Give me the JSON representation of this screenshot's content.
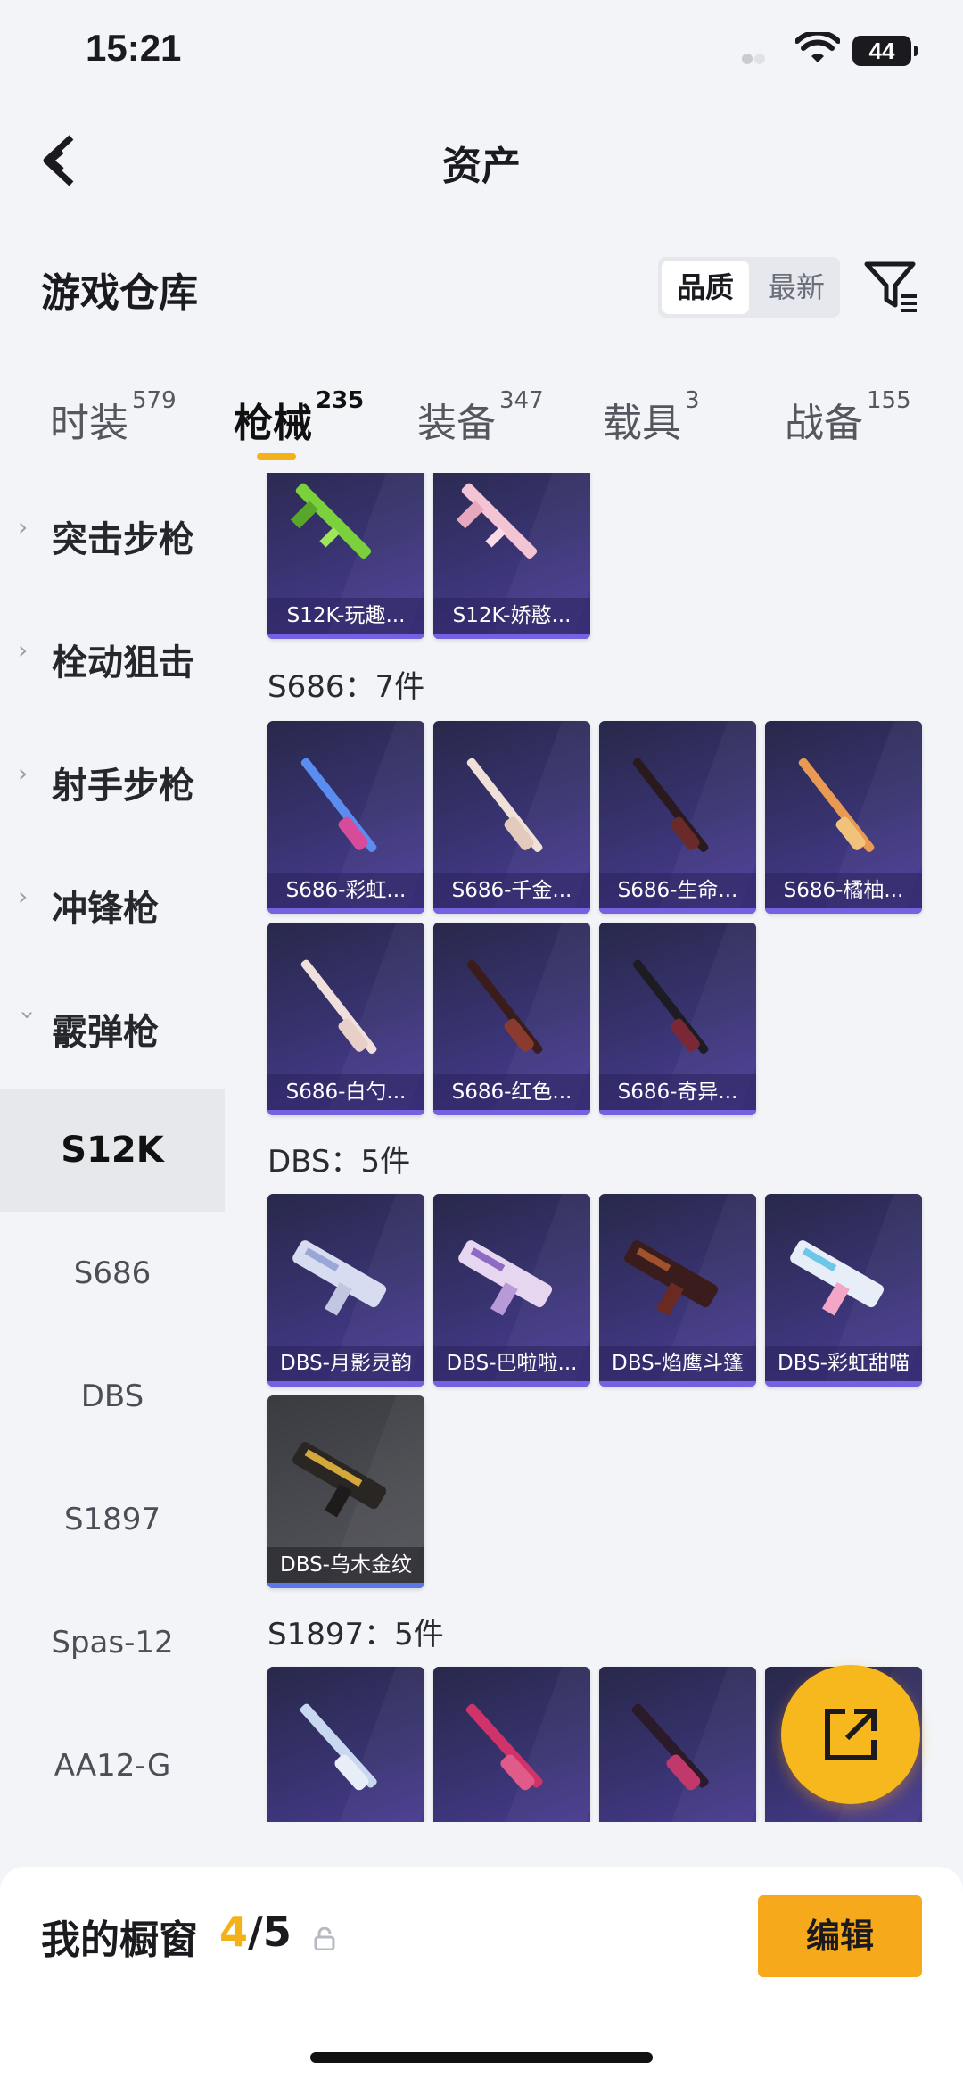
{
  "status": {
    "time": "15:21",
    "battery": "44"
  },
  "nav": {
    "title": "资产"
  },
  "header": {
    "title": "游戏仓库",
    "sort_quality": "品质",
    "sort_latest": "最新"
  },
  "tabs": [
    {
      "label": "时装",
      "count": "579"
    },
    {
      "label": "枪械",
      "count": "235"
    },
    {
      "label": "装备",
      "count": "347"
    },
    {
      "label": "载具",
      "count": "3"
    },
    {
      "label": "战备",
      "count": "155"
    }
  ],
  "sidebar": {
    "categories": [
      "突击步枪",
      "栓动狙击",
      "射手步枪",
      "冲锋枪",
      "霰弹枪"
    ],
    "subitems": [
      "S12K",
      "S686",
      "DBS",
      "S1897",
      "Spas-12",
      "AA12-G"
    ]
  },
  "groups": {
    "s12k": {
      "cards": [
        "S12K-玩趣...",
        "S12K-娇憨..."
      ]
    },
    "s686": {
      "title": "S686：7件",
      "cards": [
        "S686-彩虹...",
        "S686-千金...",
        "S686-生命...",
        "S686-橘柚...",
        "S686-白勺...",
        "S686-红色...",
        "S686-奇异..."
      ]
    },
    "dbs": {
      "title": "DBS：5件",
      "cards": [
        "DBS-月影灵韵",
        "DBS-巴啦啦...",
        "DBS-焰鹰斗篷",
        "DBS-彩虹甜喵",
        "DBS-乌木金纹"
      ]
    },
    "s1897": {
      "title": "S1897：5件"
    }
  },
  "showcase": {
    "label": "我的橱窗",
    "current": "4",
    "total": "/5",
    "edit": "编辑"
  },
  "colors": {
    "accent": "#f6a91b",
    "card_bg": "#3a3474",
    "card_bar": "#7462e0"
  }
}
